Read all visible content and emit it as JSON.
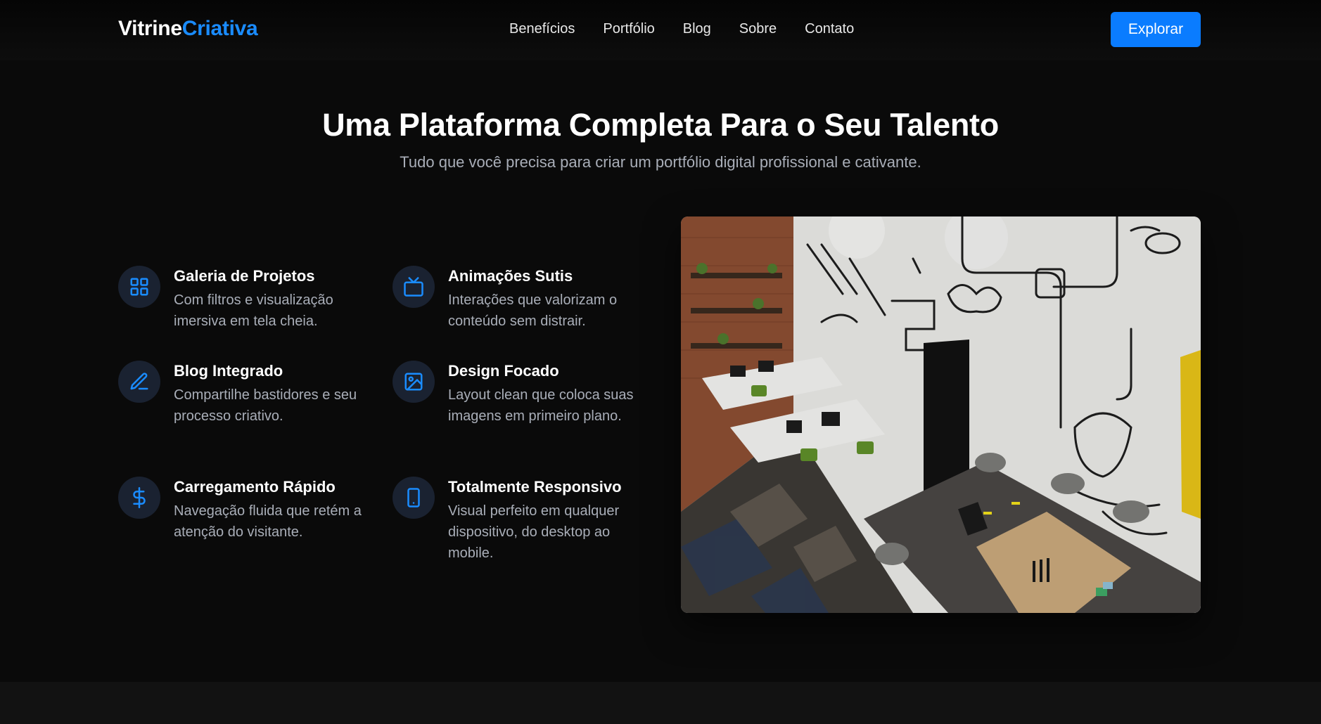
{
  "header": {
    "logo_primary": "Vitrine",
    "logo_accent": "Criativa",
    "nav": [
      "Benefícios",
      "Portfólio",
      "Blog",
      "Sobre",
      "Contato"
    ],
    "cta_label": "Explorar"
  },
  "hero": {
    "title": "Uma Plataforma Completa Para o Seu Talento",
    "subtitle": "Tudo que você precisa para criar um portfólio digital profissional e cativante."
  },
  "features": [
    {
      "icon": "grid-icon",
      "title": "Galeria de Projetos",
      "description": "Com filtros e visualização imersiva em tela cheia."
    },
    {
      "icon": "tv-icon",
      "title": "Animações Sutis",
      "description": "Interações que valorizam o conteúdo sem distrair."
    },
    {
      "icon": "pencil-icon",
      "title": "Blog Integrado",
      "description": "Compartilhe bastidores e seu processo criativo."
    },
    {
      "icon": "image-icon",
      "title": "Design Focado",
      "description": "Layout clean que coloca suas imagens em primeiro plano."
    },
    {
      "icon": "dollar-icon",
      "title": "Carregamento Rápido",
      "description": "Navegação fluida que retém a atenção do visitante."
    },
    {
      "icon": "smartphone-icon",
      "title": "Totalmente Responsivo",
      "description": "Visual perfeito em qualquer dispositivo, do desktop ao mobile."
    }
  ],
  "showcase_image": {
    "icon": "office-photo"
  },
  "colors": {
    "accent": "#0a7cff",
    "background": "#0a0a0a",
    "muted_text": "#a9aeb8",
    "icon_bg": "#1a2231"
  }
}
